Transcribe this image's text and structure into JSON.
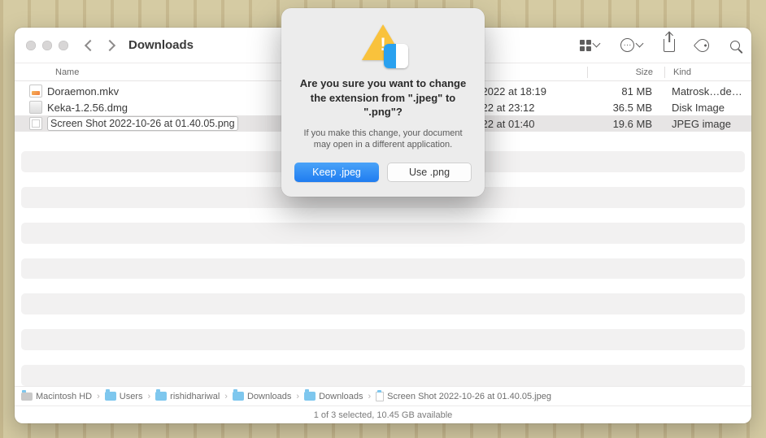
{
  "window": {
    "title": "Downloads"
  },
  "columns": {
    "name": "Name",
    "size": "Size",
    "kind": "Kind"
  },
  "files": [
    {
      "name": "Doraemon.mkv",
      "date_suffix": "0, 2022 at 18:19",
      "size": "81 MB",
      "kind": "Matrosk…deo File",
      "selected": false,
      "editing": false,
      "icon": "img"
    },
    {
      "name": "Keka-1.2.56.dmg",
      "date_suffix": "2022 at 23:12",
      "size": "36.5 MB",
      "kind": "Disk Image",
      "selected": false,
      "editing": false,
      "icon": "dmg"
    },
    {
      "name": "Screen Shot 2022-10-26 at 01.40.05.png",
      "date_suffix": "2022 at 01:40",
      "size": "19.6 MB",
      "kind": "JPEG image",
      "selected": true,
      "editing": true,
      "icon": "png"
    }
  ],
  "pathbar": {
    "segments": [
      {
        "label": "Macintosh HD",
        "icon": "hdd"
      },
      {
        "label": "Users",
        "icon": "folder"
      },
      {
        "label": "rishidhariwal",
        "icon": "folder"
      },
      {
        "label": "Downloads",
        "icon": "folder"
      },
      {
        "label": "Downloads",
        "icon": "folder"
      },
      {
        "label": "Screen Shot 2022-10-26 at 01.40.05.jpeg",
        "icon": "file"
      }
    ]
  },
  "statusbar": "1 of 3 selected, 10.45 GB available",
  "dialog": {
    "title": "Are you sure you want to change the extension from \".jpeg\" to \".png\"?",
    "message": "If you make this change, your document may open in a different application.",
    "primary": "Keep .jpeg",
    "secondary": "Use .png"
  }
}
